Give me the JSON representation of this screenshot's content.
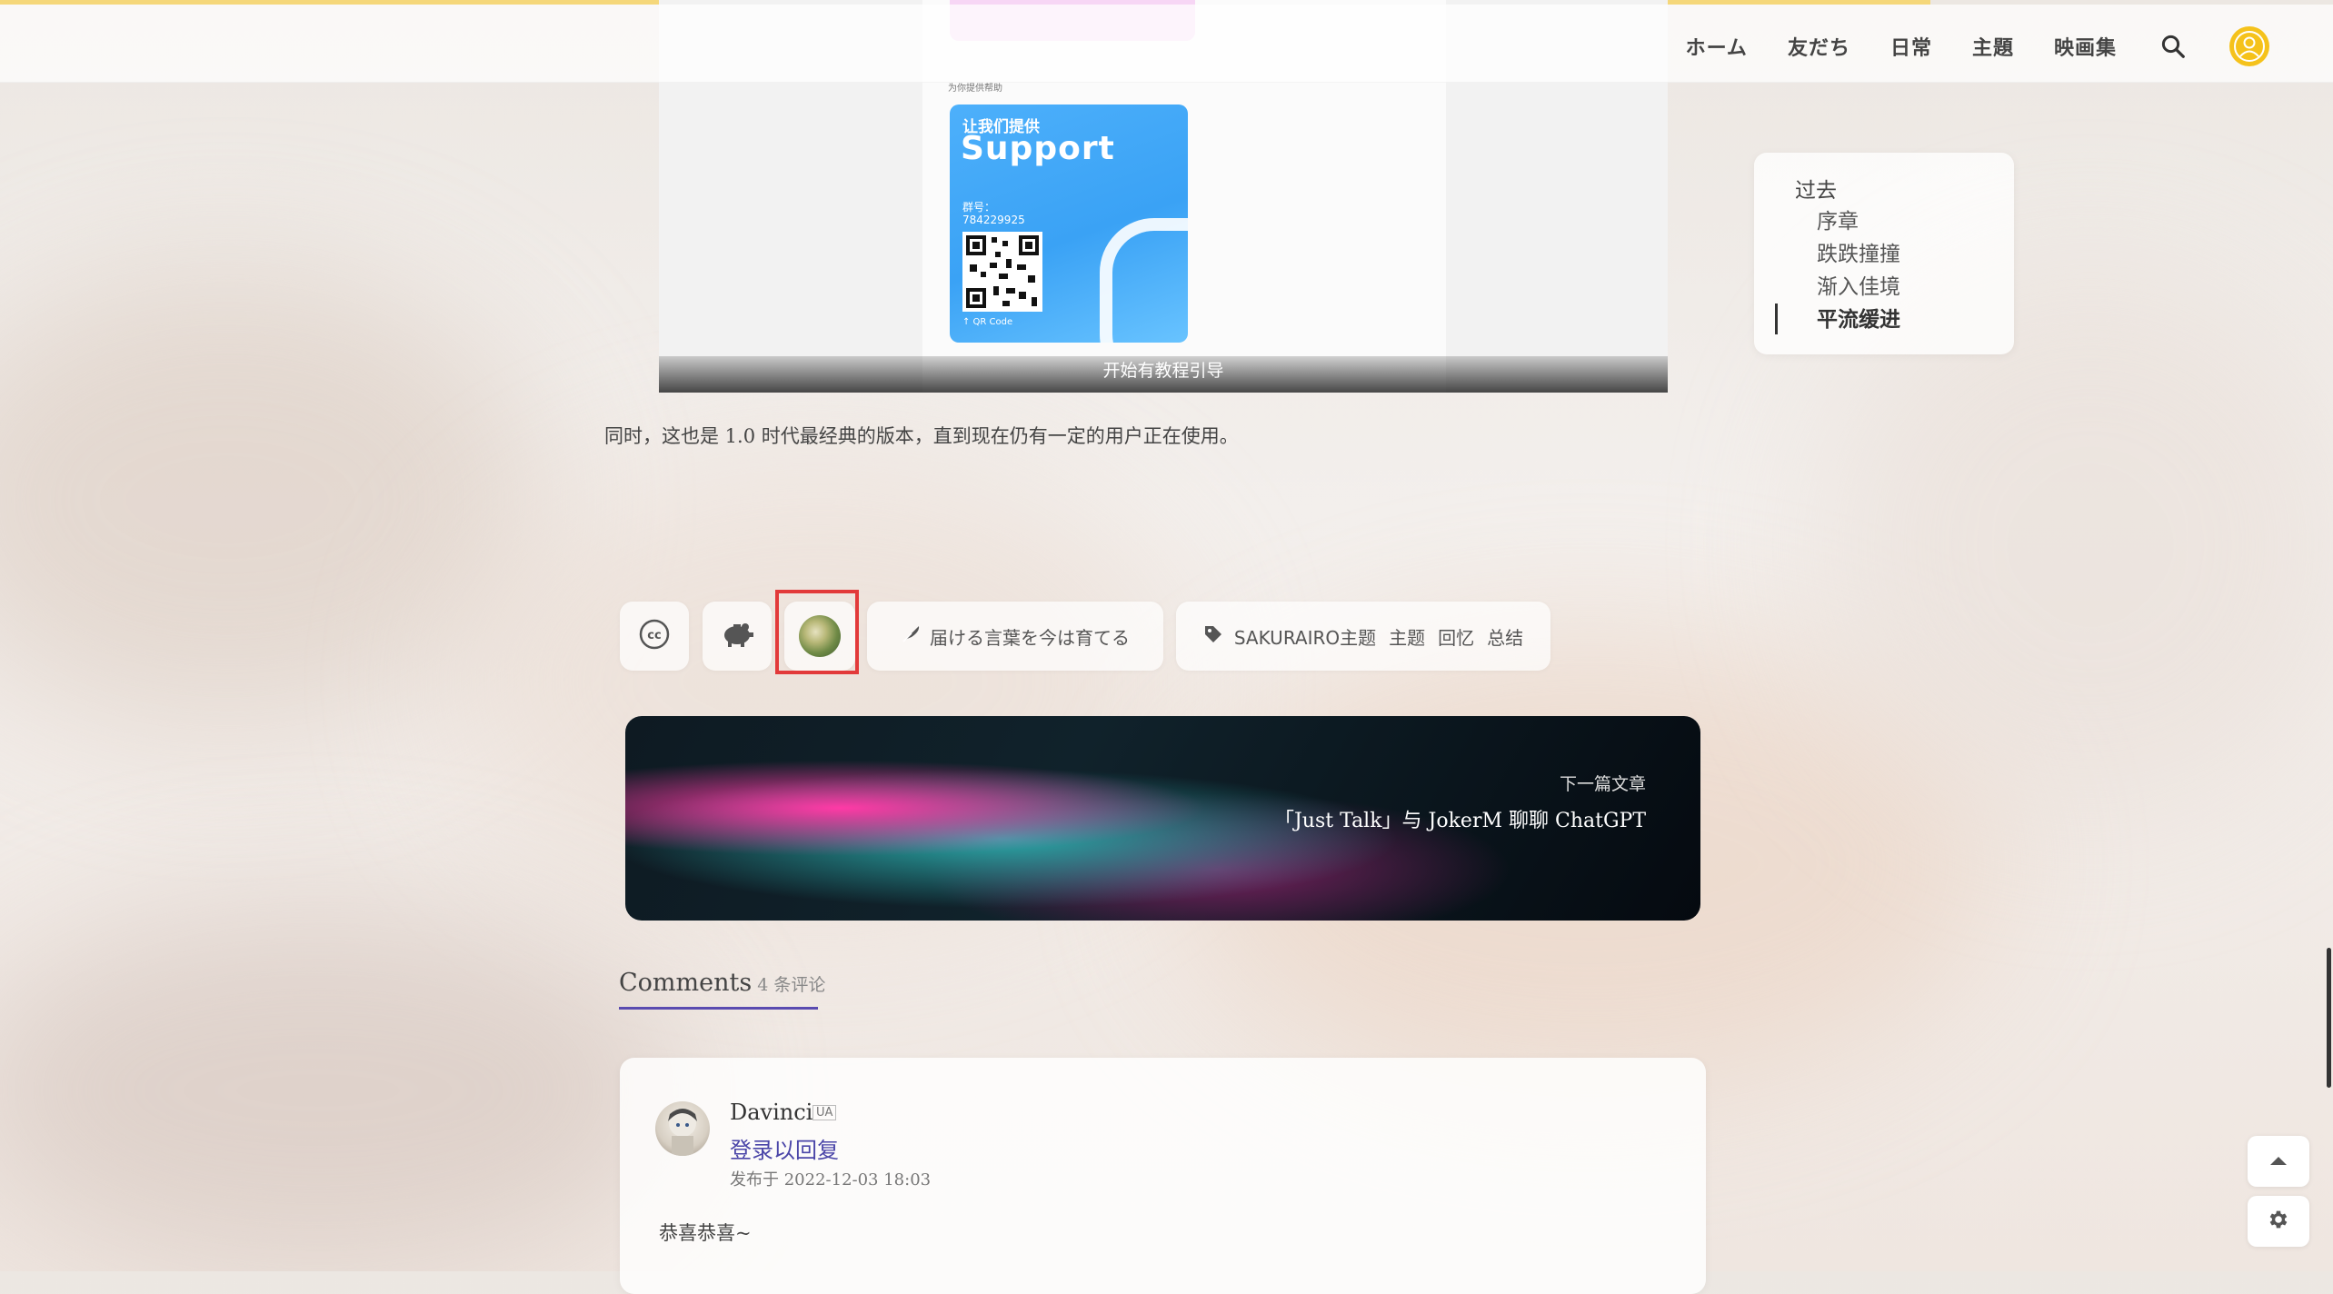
{
  "nav": {
    "items": [
      "ホーム",
      "友だち",
      "日常",
      "主題",
      "映画集"
    ]
  },
  "article": {
    "image_screen_label": "为你提供帮助",
    "support_card": {
      "line1": "让我们提供",
      "line2": "Support",
      "group_label": "群号：",
      "group_number": "784229925",
      "qr_label": "↑ QR Code"
    },
    "image_caption": "开始有教程引导",
    "paragraph": "同时，这也是 1.0 时代最经典的版本，直到现在仍有一定的用户正在使用。"
  },
  "toc": {
    "root": "过去",
    "items": [
      {
        "label": "序章",
        "active": false
      },
      {
        "label": "跌跌撞撞",
        "active": false
      },
      {
        "label": "渐入佳境",
        "active": false
      },
      {
        "label": "平流缓进",
        "active": true
      }
    ]
  },
  "meta": {
    "quote": "届ける言葉を今は育てる",
    "tags": [
      "SAKURAIRO主题",
      "主题",
      "回忆",
      "总结"
    ]
  },
  "next_post": {
    "label": "下一篇文章",
    "title": "「Just Talk」与 JokerM 聊聊 ChatGPT"
  },
  "comments": {
    "heading": "Comments",
    "count": "4 条评论",
    "items": [
      {
        "author": "Davinci",
        "badge": "UA",
        "login_prompt": "登录以回复",
        "time": "发布于 2022-12-03 18:03",
        "body": "恭喜恭喜~"
      }
    ]
  },
  "colors": {
    "progress": "#f5d77a",
    "highlight": "#e23a3a",
    "accent": "#5a4bb0",
    "support_blue": "#3aa2f5"
  }
}
